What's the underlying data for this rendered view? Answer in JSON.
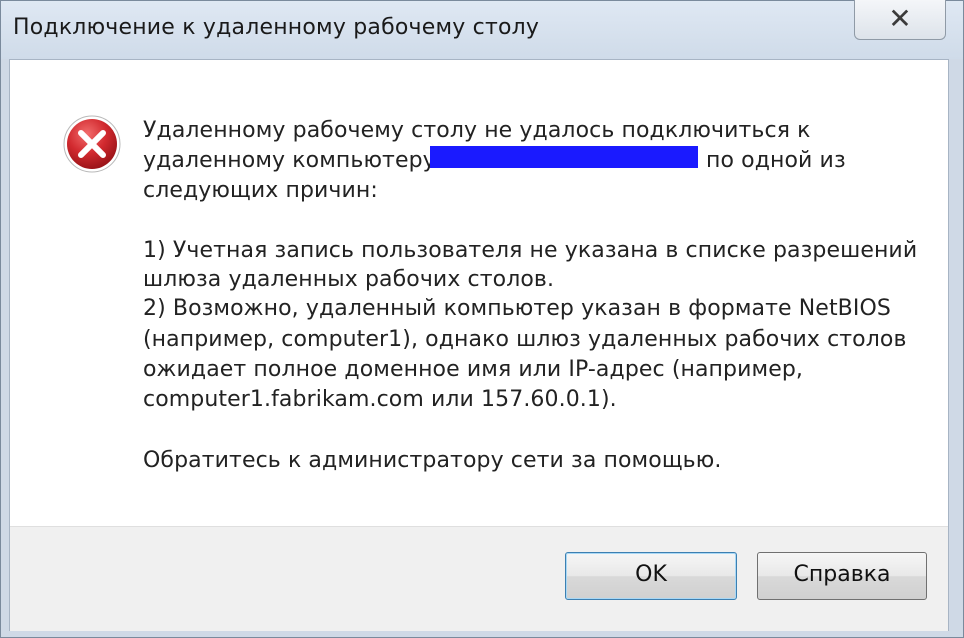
{
  "window": {
    "title": "Подключение к удаленному рабочему столу",
    "close_label": "✕"
  },
  "message": {
    "line1": "Удаленному рабочему столу не удалось подключиться к",
    "line2_start": "удаленному компьютеру",
    "line2_end": "по одной из",
    "line3": "следующих причин:",
    "reason1_line1": "1) Учетная запись пользователя не указана в списке разрешений",
    "reason1_line2": "шлюза удаленных рабочих столов.",
    "reason2_line1": "2) Возможно, удаленный компьютер указан в формате NetBIOS",
    "reason2_line2": "(например, computer1), однако шлюз удаленных рабочих столов",
    "reason2_line3": "ожидает полное доменное имя или IP-адрес (например,",
    "reason2_line4": "computer1.fabrikam.com или 157.60.0.1).",
    "contact": "Обратитесь к администратору сети за помощью."
  },
  "buttons": {
    "ok_label": "OK",
    "help_label": "Справка"
  },
  "colors": {
    "error_red": "#c8262b",
    "redaction": "#1a1aff"
  },
  "icons": {
    "error": "error-icon"
  }
}
